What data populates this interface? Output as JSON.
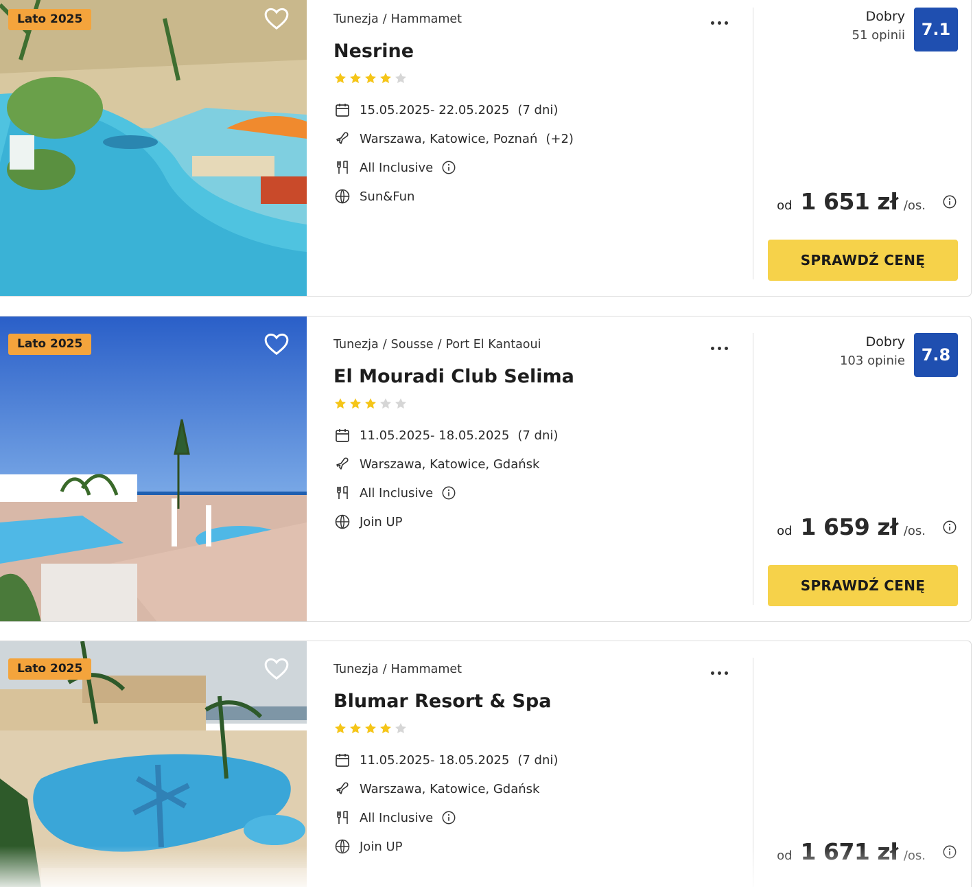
{
  "offers": [
    {
      "season_badge": "Lato 2025",
      "breadcrumb": [
        "Tunezja",
        "Hammamet"
      ],
      "name": "Nesrine",
      "stars": 4,
      "dates": "15.05.2025- 22.05.2025",
      "duration": "(7 dni)",
      "departures": "Warszawa, Katowice, Poznań",
      "departures_extra": "(+2)",
      "board": "All Inclusive",
      "program": "Sun&Fun",
      "rating_label": "Dobry",
      "rating_count": "51 opinii",
      "rating_score": "7.1",
      "price_prefix": "od",
      "price": "1 651 zł",
      "price_unit": "/os.",
      "cta_label": "SPRAWDŹ CENĘ"
    },
    {
      "season_badge": "Lato 2025",
      "breadcrumb": [
        "Tunezja",
        "Sousse",
        "Port El Kantaoui"
      ],
      "name": "El Mouradi Club Selima",
      "stars": 3,
      "dates": "11.05.2025- 18.05.2025",
      "duration": "(7 dni)",
      "departures": "Warszawa, Katowice, Gdańsk",
      "departures_extra": "",
      "board": "All Inclusive",
      "program": "Join UP",
      "rating_label": "Dobry",
      "rating_count": "103 opinie",
      "rating_score": "7.8",
      "price_prefix": "od",
      "price": "1 659 zł",
      "price_unit": "/os.",
      "cta_label": "SPRAWDŹ CENĘ"
    },
    {
      "season_badge": "Lato 2025",
      "breadcrumb": [
        "Tunezja",
        "Hammamet"
      ],
      "name": "Blumar Resort & Spa",
      "stars": 4,
      "dates": "11.05.2025- 18.05.2025",
      "duration": "(7 dni)",
      "departures": "Warszawa, Katowice, Gdańsk",
      "departures_extra": "",
      "board": "All Inclusive",
      "program": "Join UP",
      "price_prefix": "od",
      "price": "1 671 zł",
      "price_unit": "/os."
    }
  ],
  "colors": {
    "badge": "#f4a43c",
    "rating_box": "#1f4fb0",
    "cta": "#f6d24a",
    "star_filled": "#f5c518",
    "star_empty": "#d6d6d6"
  },
  "icons": {
    "favorite": "heart-outline-icon",
    "more": "more-dots-icon",
    "dates": "calendar-icon",
    "departures": "plane-icon",
    "board": "cutlery-icon",
    "program": "globe-icon",
    "info": "info-icon",
    "star": "star-icon"
  }
}
